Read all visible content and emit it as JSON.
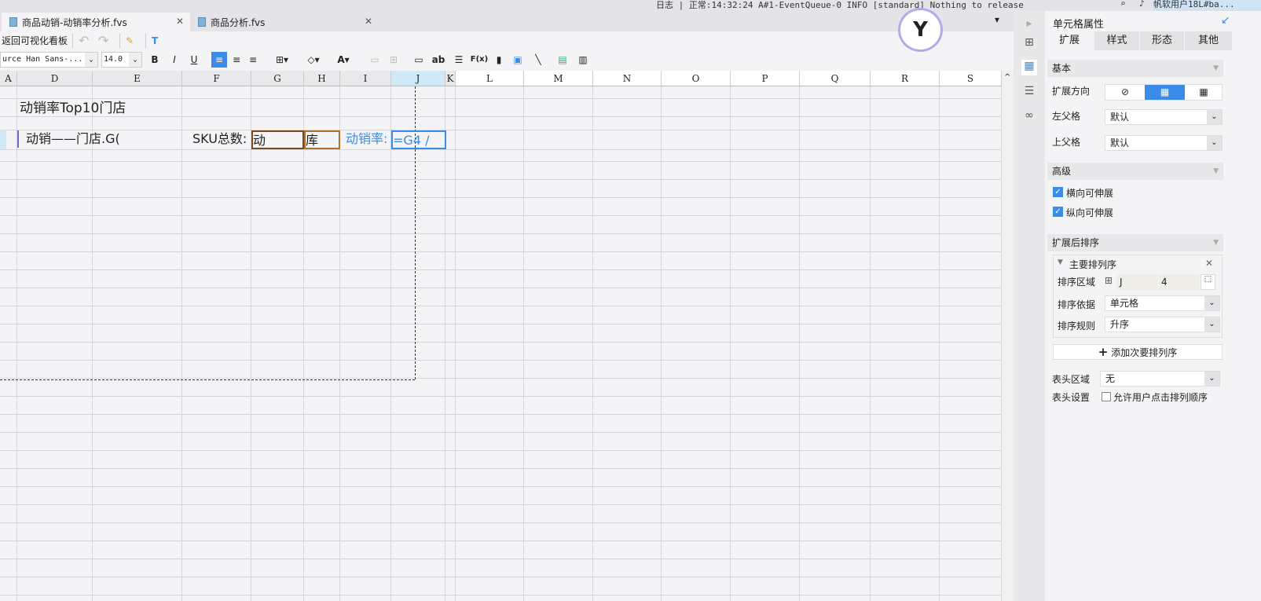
{
  "status_bar": {
    "log_text": "日志 | 正常:14:32:24 A#1-EventQueue-0 INFO [standard] Nothing to release",
    "user": "帆软用户18L#ba..."
  },
  "tabs": [
    {
      "label": "商品动销-动销率分析.fvs",
      "active": true
    },
    {
      "label": "商品分析.fvs",
      "active": false
    }
  ],
  "toolbar": {
    "back_label": "返回可视化看板",
    "font_name": "urce Han Sans-...",
    "font_size": "14.0",
    "bold": "B",
    "italic": "I",
    "underline": "U",
    "text_ab": "ab",
    "formula": "F(x)"
  },
  "sheet": {
    "columns": [
      "A",
      "D",
      "E",
      "F",
      "G",
      "H",
      "I",
      "J",
      "K",
      "L",
      "M",
      "N",
      "O",
      "P",
      "Q",
      "R",
      "S"
    ],
    "selected_column": "J",
    "cells": {
      "title": "动销率Top10门店",
      "store": "动销——门店.G(",
      "sku_label": "SKU总数:",
      "g4": "动",
      "h4": "库",
      "rate_label": "动销率:",
      "j4": "=G4 /"
    }
  },
  "panel": {
    "title": "单元格属性",
    "tabs": [
      "扩展",
      "样式",
      "形态",
      "其他"
    ],
    "active_tab": "扩展",
    "basic": {
      "header": "基本",
      "expand_dir_label": "扩展方向",
      "left_parent_label": "左父格",
      "left_parent_value": "默认",
      "top_parent_label": "上父格",
      "top_parent_value": "默认"
    },
    "advanced": {
      "header": "高级",
      "h_expand": "横向可伸展",
      "h_expand_checked": true,
      "v_expand": "纵向可伸展",
      "v_expand_checked": true
    },
    "sorting": {
      "header": "扩展后排序",
      "primary": "主要排列序",
      "area_label": "排序区域",
      "area_col": "J",
      "area_row": "4",
      "basis_label": "排序依据",
      "basis_value": "单元格",
      "rule_label": "排序规则",
      "rule_value": "升序",
      "add_secondary": "添加次要排列序"
    },
    "header_area_label": "表头区域",
    "header_area_value": "无",
    "header_setting_label": "表头设置",
    "allow_user_sort": "允许用户点击排列顺序",
    "allow_user_sort_checked": false
  },
  "colors": {
    "accent": "#3b8be8",
    "selected_col": "#cfe9f7"
  }
}
